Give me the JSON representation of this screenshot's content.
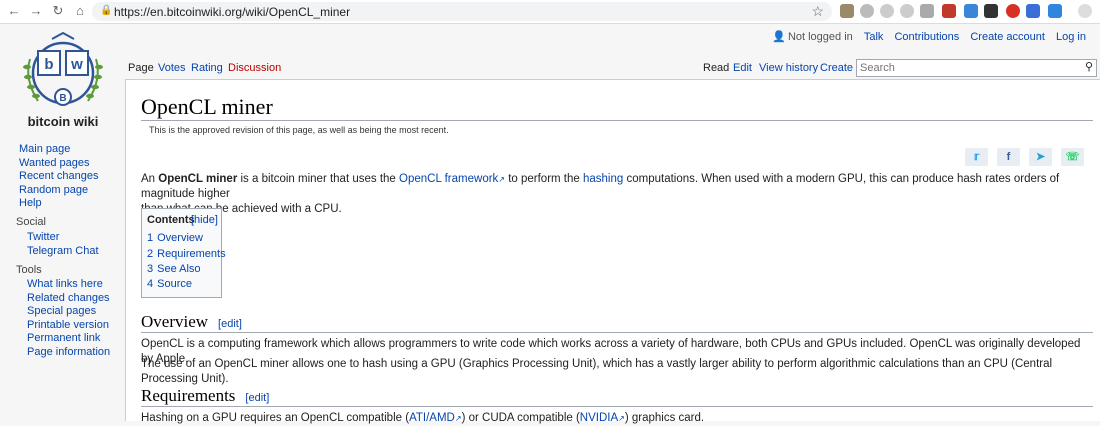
{
  "browser": {
    "url": "https://en.bitcoinwiki.org/wiki/OpenCL_miner",
    "back_icon": "arrow-left",
    "forward_icon": "arrow-right",
    "reload_icon": "reload",
    "home_icon": "home"
  },
  "logo": {
    "letter_b": "b",
    "letter_w": "w",
    "coin": "B",
    "site_name": "bitcoin wiki"
  },
  "nav": {
    "main": [
      "Main page",
      "Wanted pages",
      "Recent changes",
      "Random page",
      "Help"
    ],
    "social_heading": "Social",
    "social": [
      "Twitter",
      "Telegram Chat"
    ],
    "tools_heading": "Tools",
    "tools": [
      "What links here",
      "Related changes",
      "Special pages",
      "Printable version",
      "Permanent link",
      "Page information"
    ]
  },
  "personal": {
    "status": "Not logged in",
    "talk": "Talk",
    "contributions": "Contributions",
    "create_account": "Create account",
    "login": "Log in"
  },
  "tabs": {
    "page": "Page",
    "votes": "Votes",
    "rating": "Rating",
    "discussion": "Discussion",
    "read": "Read",
    "edit": "Edit",
    "history": "View history",
    "create": "Create"
  },
  "search": {
    "placeholder": "Search"
  },
  "article": {
    "title": "OpenCL miner",
    "revision_note": "This is the approved revision of this page, as well as being the most recent.",
    "intro_1": "An ",
    "intro_bold": "OpenCL miner",
    "intro_2": " is a bitcoin miner that uses the ",
    "intro_link1": "OpenCL framework",
    "intro_3": " to perform the ",
    "intro_link2": "hashing",
    "intro_4": " computations. When used with a modern GPU, this can produce hash rates orders of magnitude higher",
    "intro_line2": "than what can be achieved with a CPU.",
    "toc": {
      "title": "Contents",
      "hide": "[hide]",
      "items": [
        {
          "num": "1",
          "label": "Overview"
        },
        {
          "num": "2",
          "label": "Requirements"
        },
        {
          "num": "3",
          "label": "See Also"
        },
        {
          "num": "4",
          "label": "Source"
        }
      ]
    },
    "overview_heading": "Overview",
    "edit_label": "[edit]",
    "overview_p1": "OpenCL is a computing framework which allows programmers to write code which works across a variety of hardware, both CPUs and GPUs included. OpenCL was originally developed by Apple.",
    "overview_p2": "The use of an OpenCL miner allows one to hash using a GPU (Graphics Processing Unit), which has a vastly larger ability to perform algorithmic calculations than an CPU (Central Processing Unit).",
    "requirements_heading": "Requirements",
    "req_1": "Hashing on a GPU requires an OpenCL compatible (",
    "req_link1": "ATI/AMD",
    "req_2": ") or CUDA compatible (",
    "req_link2": "NVIDIA",
    "req_3": ") graphics card."
  },
  "share": {
    "twitter": "twitter-icon",
    "facebook": "facebook-icon",
    "telegram": "telegram-icon",
    "whatsapp": "whatsapp-icon"
  },
  "colors": {
    "link": "#0645ad",
    "border": "#a7d7f9",
    "rule": "#a2a9b1",
    "logo_blue": "#2f5597",
    "logo_green": "#5b9b3a"
  }
}
